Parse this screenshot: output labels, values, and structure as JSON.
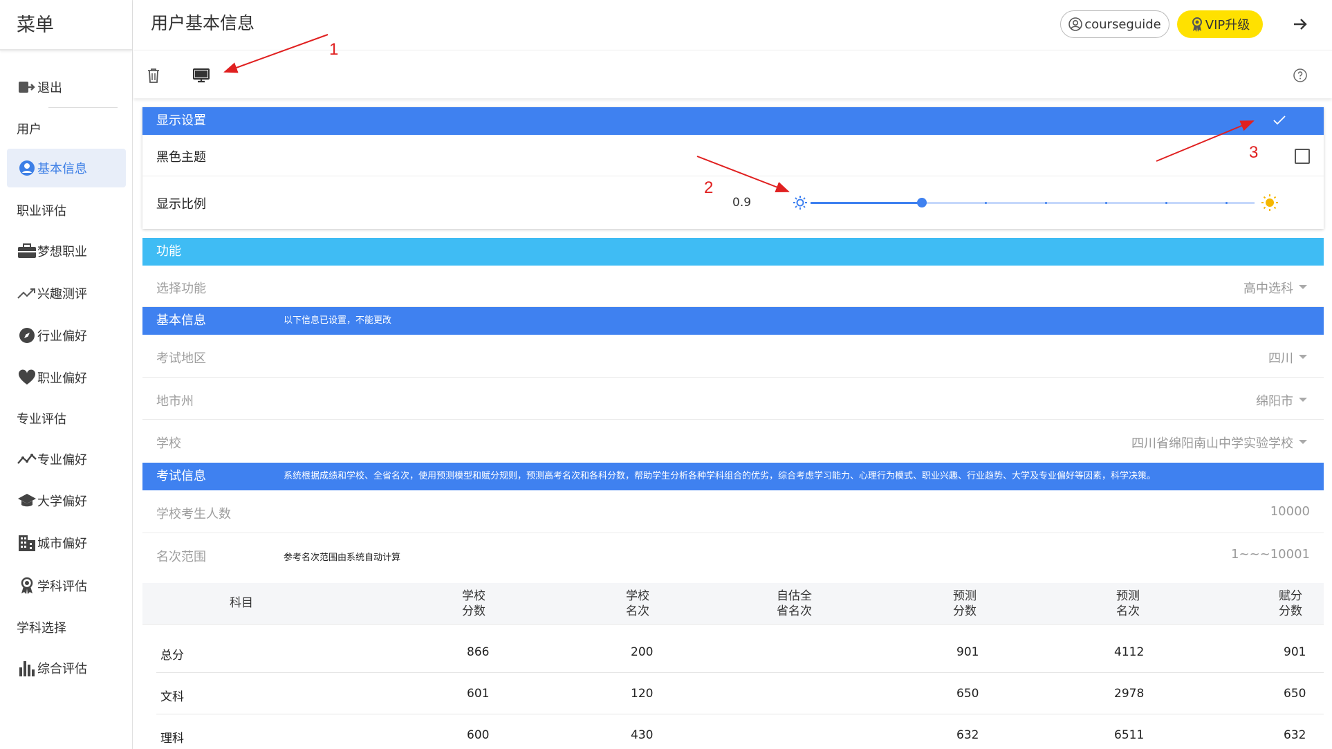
{
  "sidebar": {
    "title": "菜单",
    "items": [
      {
        "label": "退出",
        "icon": "logout-icon"
      },
      {
        "label": "用户",
        "icon": ""
      },
      {
        "label": "基本信息",
        "icon": "account-circle-icon"
      },
      {
        "label": "职业评估",
        "icon": ""
      },
      {
        "label": "梦想职业",
        "icon": "briefcase-icon"
      },
      {
        "label": "兴趣测评",
        "icon": "trending-icon"
      },
      {
        "label": "行业偏好",
        "icon": "compass-icon"
      },
      {
        "label": "职业偏好",
        "icon": "heart-icon"
      },
      {
        "label": "专业评估",
        "icon": ""
      },
      {
        "label": "专业偏好",
        "icon": "trend-line-icon"
      },
      {
        "label": "大学偏好",
        "icon": "graduation-cap-icon"
      },
      {
        "label": "城市偏好",
        "icon": "city-icon"
      },
      {
        "label": "学科评估",
        "icon": "award-icon"
      },
      {
        "label": "学科选择",
        "icon": ""
      },
      {
        "label": "综合评估",
        "icon": "bar-chart-icon"
      }
    ]
  },
  "header": {
    "title": "用户基本信息",
    "user": "courseguide",
    "vip": "VIP升级"
  },
  "display": {
    "title": "显示设置",
    "dark_theme_label": "黑色主题",
    "scale_label": "显示比例",
    "scale_value": "0.9",
    "scale_fraction": 0.25
  },
  "function": {
    "title": "功能",
    "select_label": "选择功能",
    "select_value": "高中选科"
  },
  "basic": {
    "title": "基本信息",
    "note": "以下信息已设置，不能更改",
    "region_label": "考试地区",
    "region_value": "四川",
    "city_label": "地市州",
    "city_value": "绵阳市",
    "school_label": "学校",
    "school_value": "四川省绵阳南山中学实验学校"
  },
  "exam": {
    "title": "考试信息",
    "note": "系统根据成绩和学校、全省名次，使用预测模型和赋分规则，预测高考名次和各科分数，帮助学生分析各种学科组合的优劣，综合考虑学习能力、心理行为模式、职业兴趣、行业趋势、大学及专业偏好等因素，科学决策。",
    "count_label": "学校考生人数",
    "count_value": "10000",
    "rank_label": "名次范围",
    "rank_note": "参考名次范围由系统自动计算",
    "rank_value": "1~~~10001"
  },
  "table": {
    "headers": [
      {
        "l1": "科目",
        "l2": ""
      },
      {
        "l1": "学校",
        "l2": "分数"
      },
      {
        "l1": "学校",
        "l2": "名次"
      },
      {
        "l1": "自估全",
        "l2": "省名次"
      },
      {
        "l1": "预测",
        "l2": "分数"
      },
      {
        "l1": "预测",
        "l2": "名次"
      },
      {
        "l1": "赋分",
        "l2": "分数"
      }
    ],
    "rows": [
      [
        "总分",
        "866",
        "200",
        "",
        "901",
        "4112",
        "901"
      ],
      [
        "文科",
        "601",
        "120",
        "",
        "650",
        "2978",
        "650"
      ],
      [
        "理科",
        "600",
        "430",
        "",
        "632",
        "6511",
        "632"
      ]
    ]
  },
  "annotations": [
    "1",
    "2",
    "3"
  ],
  "colors": {
    "primary": "#3f81f0",
    "cyan": "#3fbcf4",
    "vip": "#ffe100",
    "annotation": "#e02020"
  }
}
